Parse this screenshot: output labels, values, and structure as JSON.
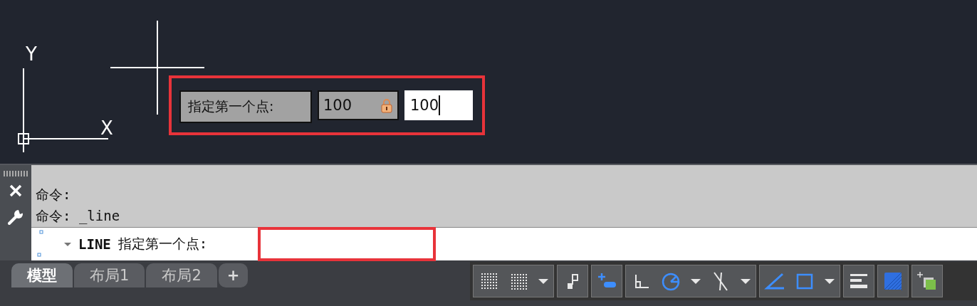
{
  "canvas": {
    "ucs": {
      "x_label": "X",
      "y_label": "Y"
    },
    "dynamic_input": {
      "prompt": "指定第一个点:",
      "fields": [
        {
          "value": "100",
          "locked": true,
          "focused": false
        },
        {
          "value": "100",
          "locked": false,
          "focused": true
        }
      ]
    }
  },
  "command_line": {
    "history": [
      "命令:",
      "命令: _line"
    ],
    "prompt_command": "LINE",
    "prompt_text": "指定第一个点:"
  },
  "layout_tabs": [
    {
      "label": "模型",
      "selected": true
    },
    {
      "label": "布局1",
      "selected": false
    },
    {
      "label": "布局2",
      "selected": false
    }
  ],
  "add_tab": "+",
  "status_bar": {
    "groups": [
      [
        {
          "kind": "grid",
          "on": false
        },
        {
          "kind": "snap",
          "on": false
        },
        {
          "kind": "dropdown",
          "on": false
        }
      ],
      [
        {
          "kind": "infer",
          "on": false
        }
      ],
      [
        {
          "kind": "dynamic",
          "on": true
        }
      ],
      [
        {
          "kind": "ortho",
          "on": false
        },
        {
          "kind": "polar",
          "on": true
        },
        {
          "kind": "dropdown",
          "on": false
        },
        {
          "kind": "track",
          "on": false
        },
        {
          "kind": "dropdown",
          "on": false
        }
      ],
      [
        {
          "kind": "iso",
          "on": true
        },
        {
          "kind": "osnap",
          "on": true
        },
        {
          "kind": "dropdown",
          "on": false
        }
      ],
      [
        {
          "kind": "lineweight",
          "on": false
        }
      ],
      [
        {
          "kind": "transparency",
          "on": true
        }
      ],
      [
        {
          "kind": "cycling",
          "on": false
        }
      ]
    ]
  }
}
